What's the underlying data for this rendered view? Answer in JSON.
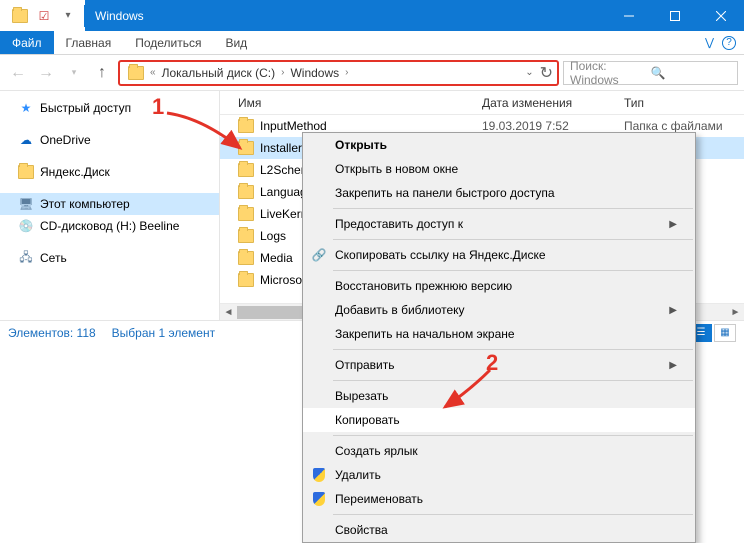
{
  "title": "Windows",
  "ribbon": {
    "file": "Файл",
    "tabs": [
      "Главная",
      "Поделиться",
      "Вид"
    ]
  },
  "breadcrumb": {
    "root_label": "Локальный диск (C:)",
    "current": "Windows"
  },
  "search": {
    "placeholder": "Поиск: Windows"
  },
  "columns": {
    "name": "Имя",
    "date": "Дата изменения",
    "type": "Тип"
  },
  "sidebar": {
    "quick": "Быстрый доступ",
    "onedrive": "OneDrive",
    "yadisk": "Яндекс.Диск",
    "thispc": "Этот компьютер",
    "cd": "CD-дисковод (H:) Beeline",
    "network": "Сеть"
  },
  "files": [
    {
      "name": "InputMethod",
      "date": "19.03.2019 7:52",
      "type": "Папка с файлами"
    },
    {
      "name": "Installer",
      "date": "",
      "type": "и"
    },
    {
      "name": "L2Schem",
      "date": "",
      "type": "и"
    },
    {
      "name": "Languag",
      "date": "",
      "type": "и"
    },
    {
      "name": "LiveKern",
      "date": "",
      "type": "и"
    },
    {
      "name": "Logs",
      "date": "",
      "type": "и"
    },
    {
      "name": "Media",
      "date": "",
      "type": "и"
    },
    {
      "name": "Microso",
      "date": "",
      "type": "и"
    }
  ],
  "menu": {
    "open": "Открыть",
    "open_new": "Открыть в новом окне",
    "pin_quick": "Закрепить на панели быстрого доступа",
    "grant_access": "Предоставить доступ к",
    "yadisk_copy": "Скопировать ссылку на Яндекс.Диске",
    "restore": "Восстановить прежнюю версию",
    "add_library": "Добавить в библиотеку",
    "pin_start": "Закрепить на начальном экране",
    "send_to": "Отправить",
    "cut": "Вырезать",
    "copy": "Копировать",
    "shortcut": "Создать ярлык",
    "delete": "Удалить",
    "rename": "Переименовать",
    "properties": "Свойства"
  },
  "status": {
    "count": "Элементов: 118",
    "selected": "Выбран 1 элемент"
  },
  "annotations": {
    "one": "1",
    "two": "2"
  }
}
